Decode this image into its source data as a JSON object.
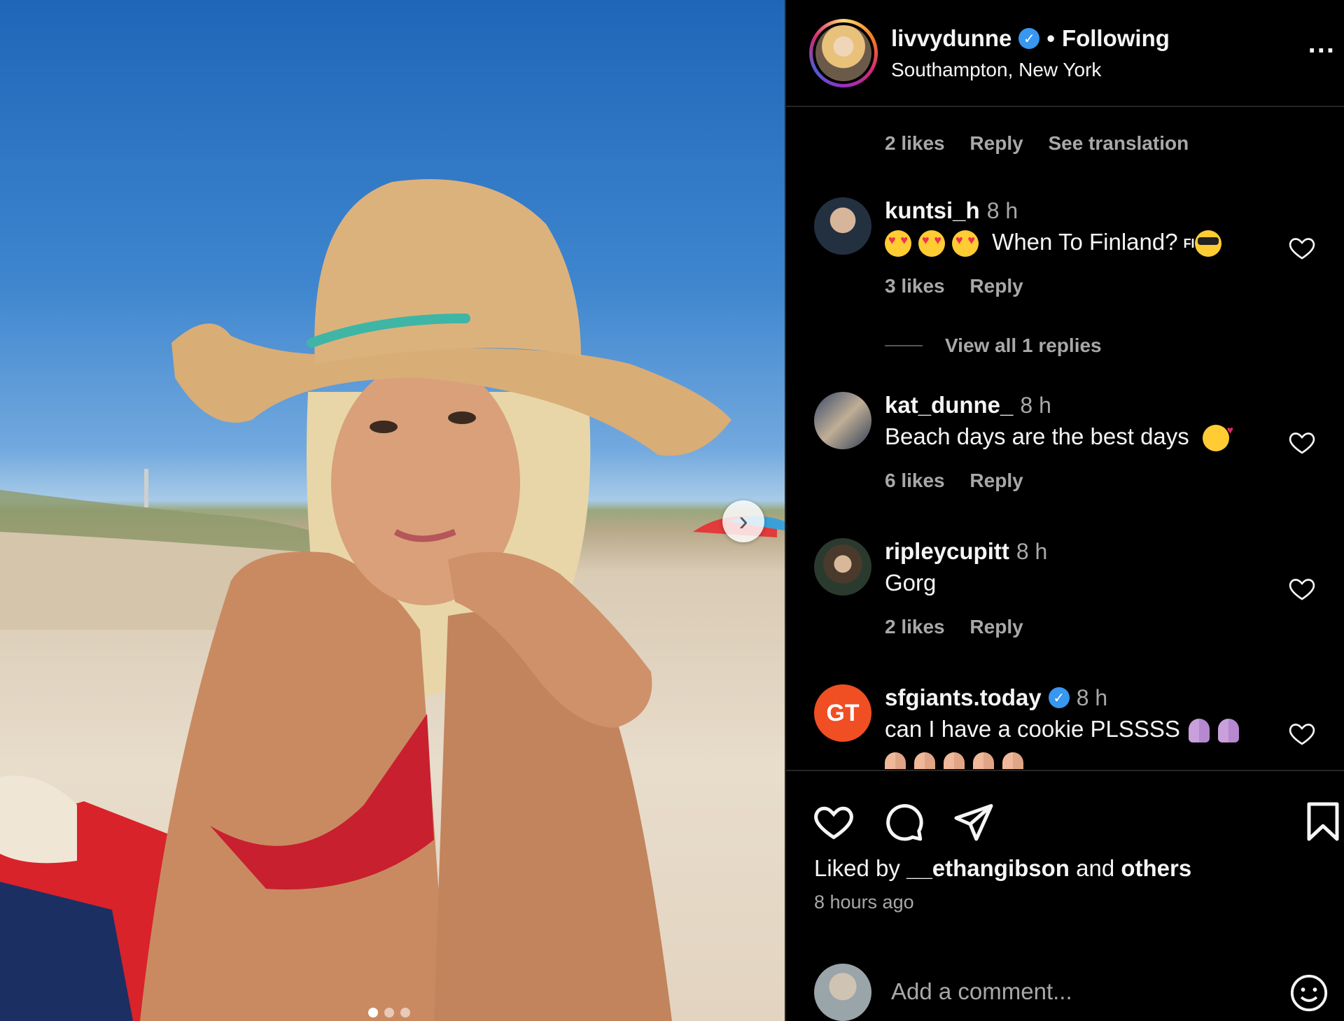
{
  "post": {
    "username": "livvydunne",
    "follow_status": "Following",
    "location": "Southampton, New York",
    "more_label": "...",
    "next_label": "›"
  },
  "comments": {
    "prev_tail": {
      "likes": "2 likes",
      "reply": "Reply",
      "translate": "See translation"
    },
    "items": [
      {
        "user": "kuntsi_h",
        "time": "8 h",
        "text": "When To Finland?",
        "likes": "3 likes",
        "reply": "Reply",
        "view_replies": "View all 1 replies",
        "flag_text": "FI"
      },
      {
        "user": "kat_dunne_",
        "time": "8 h",
        "text": "Beach days are the best days",
        "likes": "6 likes",
        "reply": "Reply"
      },
      {
        "user": "ripleycupitt",
        "time": "8 h",
        "text": "Gorg",
        "likes": "2 likes",
        "reply": "Reply"
      },
      {
        "user": "sfgiants.today",
        "time": "8 h",
        "text": "can I have a cookie PLSSSS",
        "avatar_text": "GT"
      }
    ]
  },
  "footer": {
    "liked_prefix": "Liked by",
    "liked_user": "__ethangibson",
    "liked_mid": "and",
    "liked_others": "others",
    "time_ago": "8 hours ago",
    "comment_placeholder": "Add a comment..."
  },
  "colors": {
    "background": "#000000",
    "muted": "#a8a8a8",
    "verified": "#3897f0",
    "sfgiants": "#f04e23"
  },
  "icons": [
    "verified-icon",
    "more-icon",
    "heart-icon",
    "comment-icon",
    "share-icon",
    "bookmark-icon",
    "emoji-icon",
    "chevron-right-icon"
  ]
}
